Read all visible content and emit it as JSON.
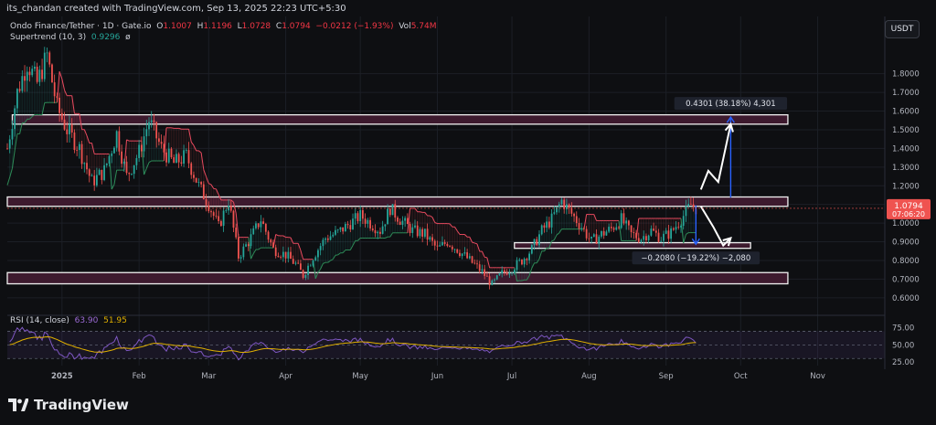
{
  "header": {
    "caption": "its_chandan created with TradingView.com, Sep 13, 2025 22:23 UTC+5:30",
    "symbol": "Ondo Finance/Tether · 1D · Gate.io",
    "open_label": "O",
    "open": "1.1007",
    "high_label": "H",
    "high": "1.1196",
    "low_label": "L",
    "low": "1.0728",
    "close_label": "C",
    "close": "1.0794",
    "change": "−0.0212 (−1.93%)",
    "vol_label": "Vol",
    "vol": "5.74M",
    "supertrend_label": "Supertrend (10, 3)",
    "supertrend_value": "0.9296",
    "supertrend_suffix": "ø"
  },
  "currency_button": "USDT",
  "price_label": {
    "value": "1.0794",
    "countdown": "07:06:20"
  },
  "rsi": {
    "label": "RSI (14, close)",
    "value": "63.90",
    "ma": "51.95"
  },
  "measure_up": "0.4301 (38.18%) 4,301",
  "measure_down": "−0.2080 (−19.22%) −2,080",
  "brand": "TradingView",
  "colors": {
    "background": "#0e0f12",
    "up": "#26a69a",
    "down": "#ef5350",
    "zone_fill": "#3d1a2e",
    "supertrend_up": "#2e8b57",
    "supertrend_down": "#e84a5f",
    "rsi_line": "#7e57c2",
    "rsi_ma": "#e0b000",
    "measure": "#2962ff"
  },
  "chart_data": {
    "type": "candlestick",
    "price_axis": {
      "ylim": [
        0.56,
        1.96
      ],
      "ticks": [
        "1.8000",
        "1.7000",
        "1.6000",
        "1.5000",
        "1.4000",
        "1.3000",
        "1.2000",
        "1.1000",
        "1.0000",
        "0.9000",
        "0.8000",
        "0.7000",
        "0.6000"
      ]
    },
    "time_axis": {
      "labels": [
        "2025",
        "Feb",
        "Mar",
        "Apr",
        "May",
        "Jun",
        "Jul",
        "Aug",
        "Sep",
        "Oct",
        "Nov"
      ],
      "dates": [
        "2025-01-01",
        "2025-02-01",
        "2025-03-01",
        "2025-04-01",
        "2025-05-01",
        "2025-06-01",
        "2025-07-01",
        "2025-08-01",
        "2025-09-01",
        "2025-10-01",
        "2025-11-01"
      ],
      "xlim": [
        "2024-12-10",
        "2025-11-28"
      ]
    },
    "price_path": [
      [
        "2024-12-10",
        1.4
      ],
      [
        "2024-12-14",
        1.7
      ],
      [
        "2024-12-18",
        1.86
      ],
      [
        "2024-12-22",
        1.75
      ],
      [
        "2024-12-26",
        1.9
      ],
      [
        "2024-12-30",
        1.62
      ],
      [
        "2025-01-03",
        1.5
      ],
      [
        "2025-01-08",
        1.4
      ],
      [
        "2025-01-13",
        1.22
      ],
      [
        "2025-01-18",
        1.28
      ],
      [
        "2025-01-23",
        1.48
      ],
      [
        "2025-01-27",
        1.25
      ],
      [
        "2025-02-01",
        1.38
      ],
      [
        "2025-02-05",
        1.55
      ],
      [
        "2025-02-10",
        1.4
      ],
      [
        "2025-02-15",
        1.32
      ],
      [
        "2025-02-20",
        1.36
      ],
      [
        "2025-02-25",
        1.2
      ],
      [
        "2025-03-01",
        1.1
      ],
      [
        "2025-03-05",
        0.98
      ],
      [
        "2025-03-09",
        1.12
      ],
      [
        "2025-03-13",
        0.82
      ],
      [
        "2025-03-17",
        0.9
      ],
      [
        "2025-03-22",
        1.02
      ],
      [
        "2025-03-27",
        0.86
      ],
      [
        "2025-04-01",
        0.83
      ],
      [
        "2025-04-05",
        0.78
      ],
      [
        "2025-04-08",
        0.72
      ],
      [
        "2025-04-12",
        0.82
      ],
      [
        "2025-04-17",
        0.92
      ],
      [
        "2025-04-22",
        0.95
      ],
      [
        "2025-04-27",
        1.0
      ],
      [
        "2025-05-01",
        1.04
      ],
      [
        "2025-05-05",
        1.0
      ],
      [
        "2025-05-09",
        0.96
      ],
      [
        "2025-05-13",
        1.08
      ],
      [
        "2025-05-17",
        1.02
      ],
      [
        "2025-05-22",
        0.96
      ],
      [
        "2025-05-27",
        0.94
      ],
      [
        "2025-06-01",
        0.86
      ],
      [
        "2025-06-05",
        0.9
      ],
      [
        "2025-06-09",
        0.86
      ],
      [
        "2025-06-14",
        0.8
      ],
      [
        "2025-06-19",
        0.74
      ],
      [
        "2025-06-23",
        0.67
      ],
      [
        "2025-06-27",
        0.73
      ],
      [
        "2025-07-01",
        0.76
      ],
      [
        "2025-07-05",
        0.8
      ],
      [
        "2025-07-09",
        0.86
      ],
      [
        "2025-07-13",
        0.96
      ],
      [
        "2025-07-17",
        1.02
      ],
      [
        "2025-07-21",
        1.12
      ],
      [
        "2025-07-25",
        1.05
      ],
      [
        "2025-07-29",
        0.98
      ],
      [
        "2025-08-02",
        0.9
      ],
      [
        "2025-08-06",
        0.94
      ],
      [
        "2025-08-10",
        0.97
      ],
      [
        "2025-08-14",
        1.02
      ],
      [
        "2025-08-18",
        0.94
      ],
      [
        "2025-08-22",
        0.92
      ],
      [
        "2025-08-26",
        0.96
      ],
      [
        "2025-08-30",
        0.92
      ],
      [
        "2025-09-03",
        0.95
      ],
      [
        "2025-09-07",
        1.02
      ],
      [
        "2025-09-11",
        1.1
      ],
      [
        "2025-09-13",
        1.08
      ]
    ],
    "zones": [
      {
        "name": "resistance-zone",
        "from": "2024-12-12",
        "to": "2025-10-20",
        "low": 1.53,
        "high": 1.58
      },
      {
        "name": "mid-zone",
        "from": "2024-12-10",
        "to": "2025-10-20",
        "low": 1.09,
        "high": 1.14
      },
      {
        "name": "support-zone",
        "from": "2025-07-02",
        "to": "2025-10-05",
        "low": 0.865,
        "high": 0.895
      },
      {
        "name": "lower-zone",
        "from": "2024-12-10",
        "to": "2025-10-20",
        "low": 0.675,
        "high": 0.735
      }
    ],
    "measure_up": {
      "date": "2025-09-27",
      "from": 1.137,
      "to": 1.568
    },
    "measure_down": {
      "date": "2025-09-13",
      "from": 1.095,
      "to": 0.887
    },
    "projection_up": [
      [
        "2025-09-15",
        1.18
      ],
      [
        "2025-09-18",
        1.28
      ],
      [
        "2025-09-22",
        1.22
      ],
      [
        "2025-09-27",
        1.53
      ]
    ],
    "projection_down": [
      [
        "2025-09-15",
        1.09
      ],
      [
        "2025-09-20",
        0.98
      ],
      [
        "2025-09-24",
        0.88
      ],
      [
        "2025-09-27",
        0.92
      ]
    ],
    "rsi": {
      "ylim": [
        25,
        80
      ],
      "ticks": [
        "75.00",
        "50.00",
        "25.00"
      ],
      "levels": [
        70,
        50,
        30
      ]
    }
  }
}
